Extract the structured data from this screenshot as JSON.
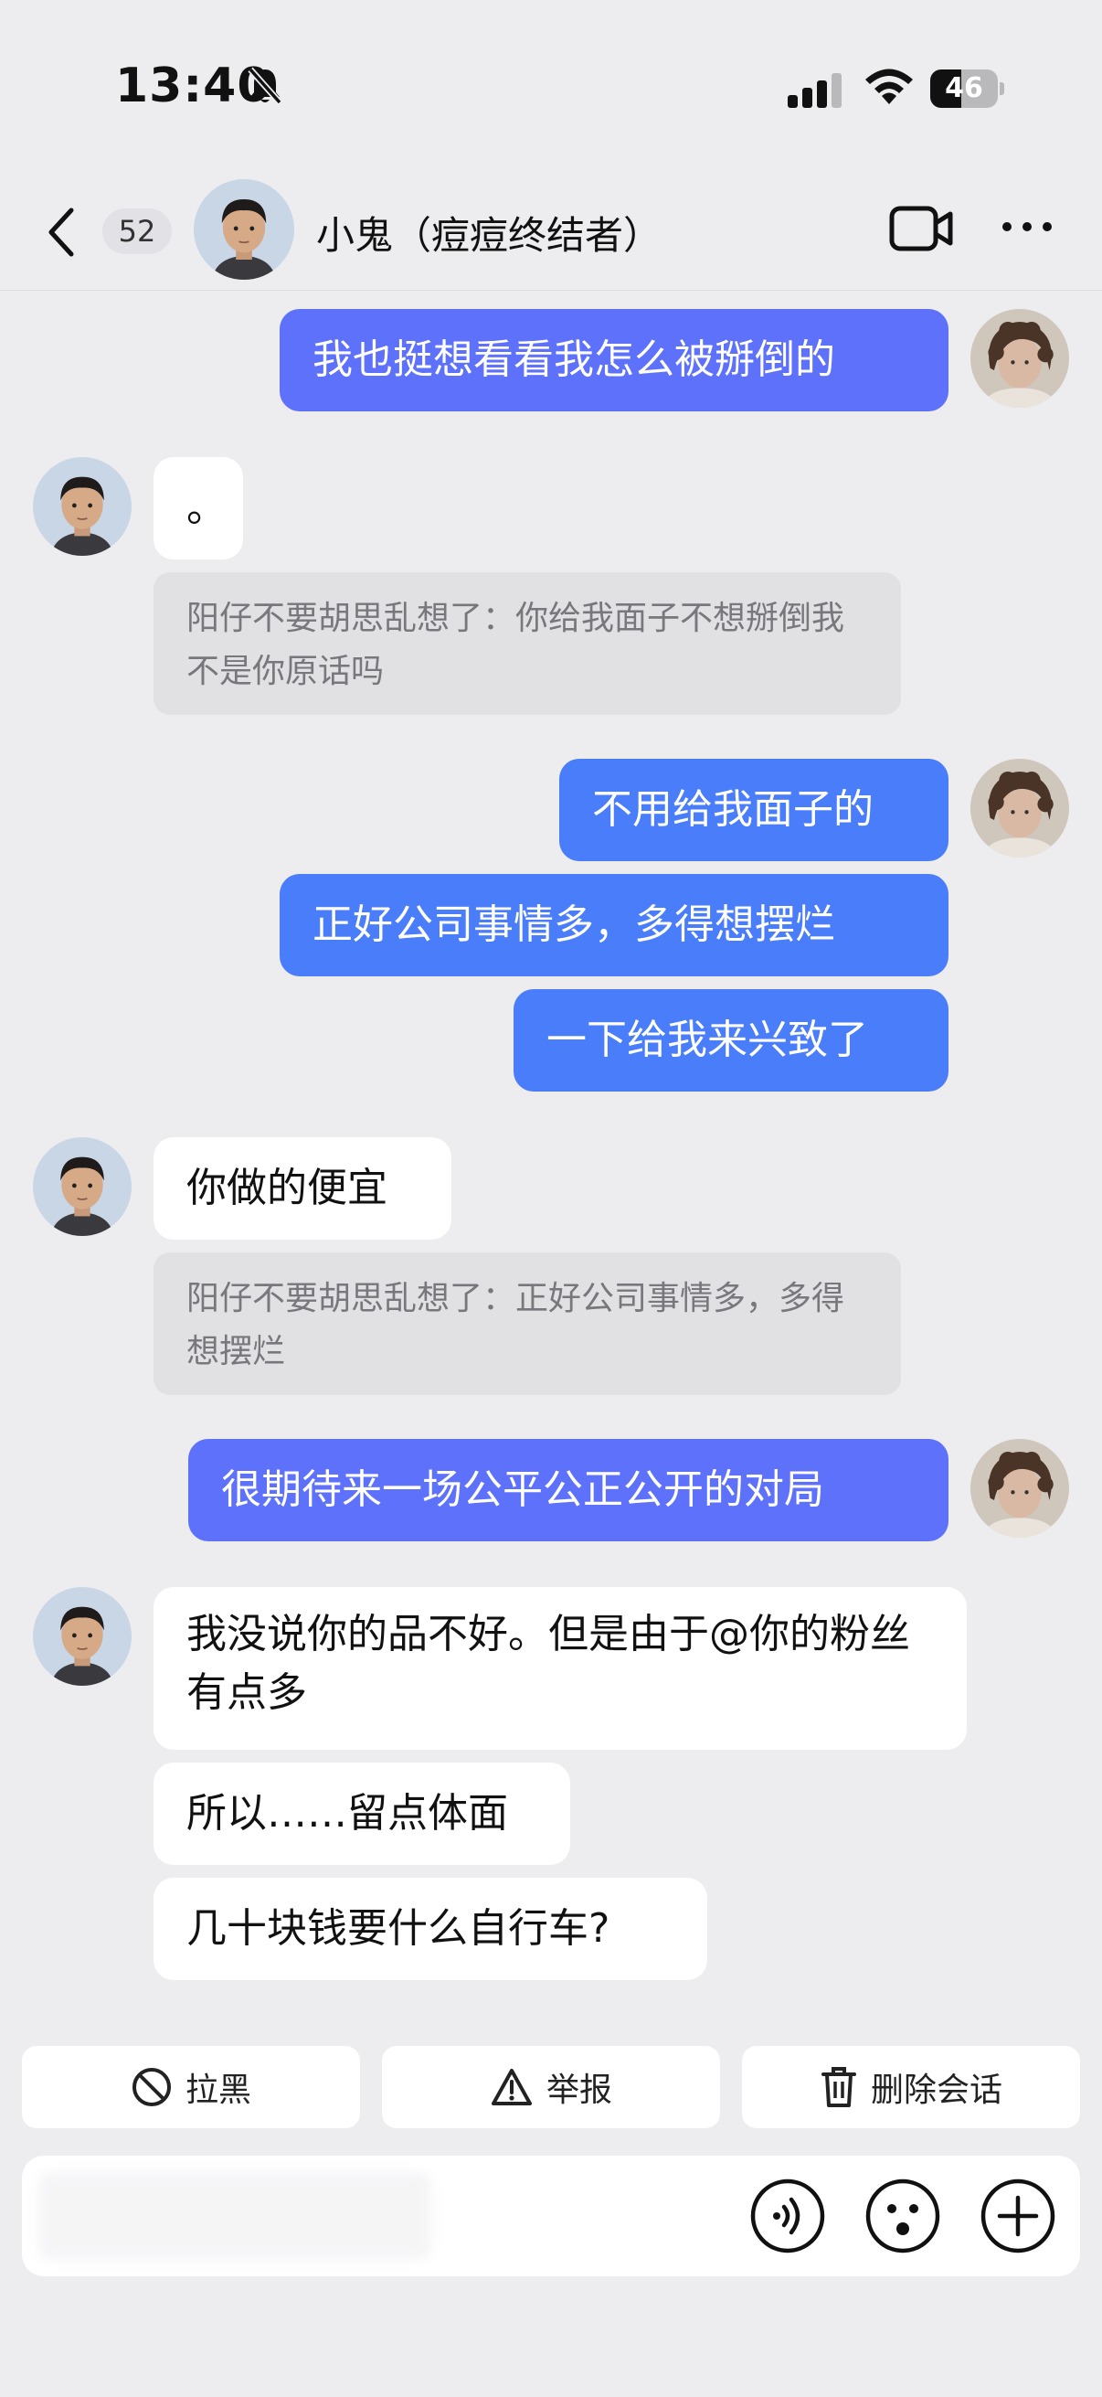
{
  "status_bar": {
    "time": "13:40",
    "battery": "46",
    "battery_level": 0.46
  },
  "nav": {
    "unread_count": "52",
    "title": "小鬼（痘痘终结者）"
  },
  "messages": {
    "m1": "我也挺想看看我怎么被掰倒的",
    "m2": "。",
    "q1": "阳仔不要胡思乱想了：你给我面子不想掰倒我不是你原话吗",
    "m3": "不用给我面子的",
    "m4": "正好公司事情多，多得想摆烂",
    "m5": "一下给我来兴致了",
    "m6": "你做的便宜",
    "q2": "阳仔不要胡思乱想了：正好公司事情多，多得想摆烂",
    "m7": "很期待来一场公平公正公开的对局",
    "m8": "我没说你的品不好。但是由于@你的粉丝有点多",
    "m9": "所以……留点体面",
    "m10": "几十块钱要什么自行车?"
  },
  "actions": {
    "block": "拉黑",
    "report": "举报",
    "delete": "删除会话"
  },
  "colors": {
    "background": "#ededf0",
    "my_bubble": "#5d71fb",
    "my_bubble_alt": "#4a7dfa",
    "their_bubble": "#ffffff",
    "quote_bg": "#e1e1e4"
  }
}
